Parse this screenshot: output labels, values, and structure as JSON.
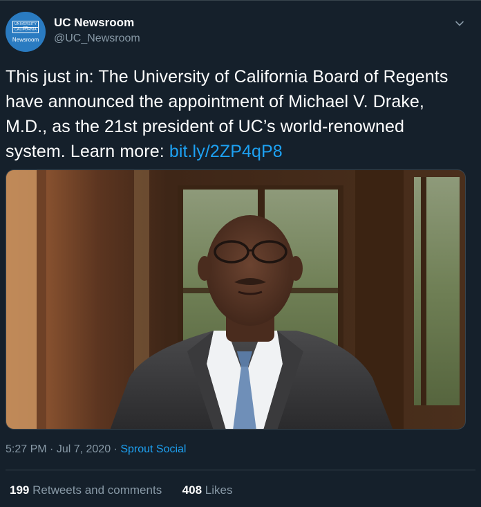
{
  "account": {
    "display_name": "UC Newsroom",
    "handle": "@UC_Newsroom",
    "avatar_seal_line1": "UNIVERSITY OF",
    "avatar_seal_line2": "CALIFORNIA",
    "avatar_word": "Newsroom"
  },
  "tweet": {
    "text_before_link": "This just in: The University of California Board of Regents have announced the appointment of Michael V. Drake, M.D., as the 21st president of UC’s world-renowned system. Learn more: ",
    "link_text": "bit.ly/2ZP4qP8"
  },
  "meta": {
    "time": "5:27 PM",
    "separator": " · ",
    "date": "Jul 7, 2020",
    "source": "Sprout Social"
  },
  "stats": {
    "retweets_count": "199",
    "retweets_label": "Retweets and comments",
    "likes_count": "408",
    "likes_label": "Likes"
  },
  "icons": {
    "chevron": "chevron-down-icon"
  },
  "colors": {
    "background": "#15202b",
    "link": "#1da1f2",
    "secondary_text": "#8899a6",
    "border": "#38444d"
  }
}
